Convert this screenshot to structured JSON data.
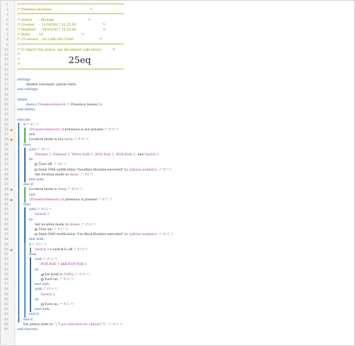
{
  "colors": {
    "comment": "#8a8a00",
    "keyword": "#2e55b8",
    "device": "#a040a0",
    "value": "#a040a0",
    "text": "#333333",
    "gray": "#999999",
    "bar_green": "#4caf50",
    "bar_blue": "#4a8ccf",
    "bar_blue2": "#2f6fa8",
    "gutter_icon": "#e08040"
  },
  "large_text": "25eq",
  "lines": [
    {
      "n": "1",
      "indent": 0,
      "segs": [
        {
          "t": "/*****************************************************************",
          "c": "comment"
        }
      ]
    },
    {
      "n": "2",
      "indent": 0,
      "segs": [
        {
          "t": "/* Presence Routines                                     */",
          "c": "comment"
        }
      ]
    },
    {
      "n": "3",
      "indent": 0,
      "segs": [
        {
          "t": "/*****************************************************************",
          "c": "comment"
        }
      ]
    },
    {
      "n": "4",
      "indent": 0,
      "segs": [
        {
          "t": "/* Author      : Michael                                 */",
          "c": "comment"
        }
      ]
    },
    {
      "n": "5",
      "indent": 0,
      "segs": [
        {
          "t": "/* Created     : 11/10/2017 22:25:39                          */",
          "c": "comment"
        }
      ]
    },
    {
      "n": "6",
      "indent": 0,
      "segs": [
        {
          "t": "/* Modified    : 28/10/2017 21:55:46                          */",
          "c": "comment"
        }
      ]
    },
    {
      "n": "7",
      "indent": 0,
      "segs": [
        {
          "t": "/* Build       : 19                                     */",
          "c": "comment"
        }
      ]
    },
    {
      "n": "8",
      "indent": 0,
      "segs": [
        {
          "t": "/* UI version  : v0.2.0fb.20171026                         */",
          "c": "comment"
        }
      ]
    },
    {
      "n": "9",
      "indent": 0,
      "segs": [
        {
          "t": "/*****************************************************************",
          "c": "comment"
        }
      ]
    },
    {
      "n": "10",
      "indent": 0,
      "segs": [
        {
          "t": "/* To import this piston, use the import code below:          */",
          "c": "comment"
        }
      ]
    },
    {
      "n": "11",
      "indent": 0,
      "segs": [
        {
          "t": "/*",
          "c": "comment"
        }
      ]
    },
    {
      "n": "12",
      "indent": 0,
      "segs": [
        {
          "t": "/*",
          "c": "comment"
        }
      ]
    },
    {
      "n": "13",
      "indent": 0,
      "segs": [
        {
          "t": "/*",
          "c": "comment"
        }
      ]
    },
    {
      "n": "14",
      "indent": 0,
      "segs": [
        {
          "t": "/*****************************************************************",
          "c": "comment"
        }
      ]
    },
    {
      "n": "15",
      "indent": 0,
      "segs": []
    },
    {
      "n": "16",
      "indent": 0,
      "segs": [
        {
          "t": "settings",
          "c": "keyword"
        }
      ]
    },
    {
      "n": "17",
      "indent": 3,
      "segs": [
        {
          "t": "disable automatic piston state;",
          "c": "text"
        }
      ]
    },
    {
      "n": "18",
      "indent": 0,
      "segs": [
        {
          "t": "end settings;",
          "c": "keyword"
        }
      ]
    },
    {
      "n": "19",
      "indent": 0,
      "segs": []
    },
    {
      "n": "20",
      "indent": 0,
      "segs": [
        {
          "t": "define",
          "c": "keyword"
        }
      ]
    },
    {
      "n": "21",
      "indent": 3,
      "segs": [
        {
          "t": "device ",
          "c": "keyword"
        },
        {
          "t": "PresenceSensors",
          "c": "device"
        },
        {
          "t": " = Presence Sensor 3;",
          "c": "text"
        }
      ]
    },
    {
      "n": "22",
      "indent": 0,
      "segs": [
        {
          "t": "end define;",
          "c": "keyword"
        }
      ]
    },
    {
      "n": "23",
      "indent": 0,
      "segs": []
    },
    {
      "n": "24",
      "indent": 0,
      "segs": [
        {
          "t": "execute",
          "c": "keyword"
        }
      ]
    },
    {
      "n": "25",
      "indent": 2,
      "segs": [
        {
          "t": "if ",
          "c": "keyword"
        },
        {
          "t": "/* #2 */",
          "c": "gray"
        }
      ]
    },
    {
      "n": "26",
      "indent": 4,
      "icon": true,
      "segs": [
        {
          "t": "{PresenceSensors}",
          "c": "device"
        },
        {
          "t": "'s presence is not present ",
          "c": "text"
        },
        {
          "t": "/* #26 */",
          "c": "gray"
        }
      ]
    },
    {
      "n": "27",
      "indent": 4,
      "segs": [
        {
          "t": "and",
          "c": "keyword"
        }
      ]
    },
    {
      "n": "28",
      "indent": 4,
      "icon": true,
      "segs": [
        {
          "t": "Location mode is not ",
          "c": "text"
        },
        {
          "t": "Away",
          "c": "value"
        },
        {
          "t": " /* #28 */",
          "c": "gray"
        }
      ]
    },
    {
      "n": "29",
      "indent": 2,
      "segs": [
        {
          "t": "then",
          "c": "keyword"
        }
      ]
    },
    {
      "n": "30",
      "indent": 4,
      "segs": [
        {
          "t": "with ",
          "c": "keyword"
        },
        {
          "t": "/* #5 */",
          "c": "gray"
        }
      ]
    },
    {
      "n": "31",
      "indent": 6,
      "segs": [
        {
          "t": "Dimmer 1, Dimmer 2, White Bulb 1, RGB Bulb 1, RGB Bulb 2, ",
          "c": "device"
        },
        {
          "t": "and ",
          "c": "text"
        },
        {
          "t": "Switch 2",
          "c": "device"
        }
      ]
    },
    {
      "n": "32",
      "indent": 4,
      "segs": [
        {
          "t": "do",
          "c": "keyword"
        }
      ]
    },
    {
      "n": "33",
      "indent": 6,
      "ic": "power",
      "segs": [
        {
          "t": " Turn off; ",
          "c": "text"
        },
        {
          "t": "/* #6 */",
          "c": "gray"
        }
      ]
    },
    {
      "n": "34",
      "indent": 6,
      "ic": "msg",
      "segs": [
        {
          "t": " Send SMS notification \"Goodbye Routine executed\" to ",
          "c": "text"
        },
        {
          "t": "{phone number}",
          "c": "value"
        },
        {
          "t": "; /* #7 */",
          "c": "gray"
        }
      ]
    },
    {
      "n": "35",
      "indent": 6,
      "segs": [
        {
          "t": "Set location mode to ",
          "c": "text"
        },
        {
          "t": "Away",
          "c": "value"
        },
        {
          "t": "; /* #8 */",
          "c": "gray"
        }
      ]
    },
    {
      "n": "36",
      "indent": 4,
      "segs": [
        {
          "t": "end with;",
          "c": "keyword"
        }
      ]
    },
    {
      "n": "37",
      "indent": 2,
      "segs": [
        {
          "t": "else if",
          "c": "keyword"
        }
      ]
    },
    {
      "n": "38",
      "indent": 4,
      "icon": true,
      "segs": [
        {
          "t": "Location mode is ",
          "c": "text"
        },
        {
          "t": "Away",
          "c": "value"
        },
        {
          "t": " /* #30 */",
          "c": "gray"
        }
      ]
    },
    {
      "n": "39",
      "indent": 4,
      "segs": [
        {
          "t": "and",
          "c": "keyword"
        }
      ]
    },
    {
      "n": "40",
      "indent": 4,
      "icon": true,
      "segs": [
        {
          "t": "{PresenceSensors}",
          "c": "device"
        },
        {
          "t": "'s presence is present ",
          "c": "text"
        },
        {
          "t": "/* #27 */",
          "c": "gray"
        }
      ]
    },
    {
      "n": "41",
      "indent": 2,
      "segs": [
        {
          "t": "then",
          "c": "keyword"
        }
      ]
    },
    {
      "n": "42",
      "indent": 4,
      "segs": [
        {
          "t": "with ",
          "c": "keyword"
        },
        {
          "t": "/* #16 */",
          "c": "gray"
        }
      ]
    },
    {
      "n": "43",
      "indent": 6,
      "segs": [
        {
          "t": "Switch 3",
          "c": "device"
        }
      ]
    },
    {
      "n": "44",
      "indent": 4,
      "segs": [
        {
          "t": "do",
          "c": "keyword"
        }
      ]
    },
    {
      "n": "45",
      "indent": 6,
      "segs": [
        {
          "t": "Set location mode to ",
          "c": "text"
        },
        {
          "t": "Home",
          "c": "value"
        },
        {
          "t": "; /* #14 */",
          "c": "gray"
        }
      ]
    },
    {
      "n": "46",
      "indent": 6,
      "ic": "power",
      "segs": [
        {
          "t": " Turn on; ",
          "c": "text"
        },
        {
          "t": "/* #17 */",
          "c": "gray"
        }
      ]
    },
    {
      "n": "47",
      "indent": 6,
      "ic": "msg",
      "segs": [
        {
          "t": " Send SMS notification \"I'm Back Routine executed\" to ",
          "c": "text"
        },
        {
          "t": "{phone number}",
          "c": "value"
        },
        {
          "t": "; /* #15 */",
          "c": "gray"
        }
      ]
    },
    {
      "n": "48",
      "indent": 4,
      "segs": [
        {
          "t": "end with;",
          "c": "keyword"
        }
      ]
    },
    {
      "n": "49",
      "indent": 4,
      "segs": [
        {
          "t": "if ",
          "c": "keyword"
        },
        {
          "t": "/* #12 */",
          "c": "gray"
        }
      ]
    },
    {
      "n": "50",
      "indent": 6,
      "icon": true,
      "segs": [
        {
          "t": "Switch 1",
          "c": "device"
        },
        {
          "t": "'s switch is off ",
          "c": "text"
        },
        {
          "t": "/* #18 */",
          "c": "gray"
        }
      ]
    },
    {
      "n": "51",
      "indent": 4,
      "segs": [
        {
          "t": "then",
          "c": "keyword"
        }
      ]
    },
    {
      "n": "52",
      "indent": 6,
      "segs": [
        {
          "t": "with ",
          "c": "keyword"
        },
        {
          "t": "/* #21 */",
          "c": "gray"
        }
      ]
    },
    {
      "n": "53",
      "indent": 8,
      "segs": [
        {
          "t": "RGB Bulb 1",
          "c": "device"
        },
        {
          "t": " and ",
          "c": "text"
        },
        {
          "t": "RGB Bulb 2",
          "c": "device"
        }
      ]
    },
    {
      "n": "54",
      "indent": 6,
      "segs": [
        {
          "t": "do",
          "c": "keyword"
        }
      ]
    },
    {
      "n": "55",
      "indent": 8,
      "ic": "level",
      "segs": [
        {
          "t": " Set level to ",
          "c": "text"
        },
        {
          "t": "100%",
          "c": "value"
        },
        {
          "t": "; /* #23 */",
          "c": "gray"
        }
      ]
    },
    {
      "n": "56",
      "indent": 8,
      "ic": "power",
      "segs": [
        {
          "t": " Turn on; ",
          "c": "text"
        },
        {
          "t": "/* #22 */",
          "c": "gray"
        }
      ]
    },
    {
      "n": "57",
      "indent": 6,
      "segs": [
        {
          "t": "end with;",
          "c": "keyword"
        }
      ]
    },
    {
      "n": "58",
      "indent": 6,
      "segs": [
        {
          "t": "with ",
          "c": "keyword"
        },
        {
          "t": "/* #24 */",
          "c": "gray"
        }
      ]
    },
    {
      "n": "59",
      "indent": 8,
      "segs": [
        {
          "t": "Switch 2",
          "c": "device"
        }
      ]
    },
    {
      "n": "60",
      "indent": 6,
      "segs": [
        {
          "t": "do",
          "c": "keyword"
        }
      ]
    },
    {
      "n": "61",
      "indent": 8,
      "ic": "power",
      "segs": [
        {
          "t": " Turn on; ",
          "c": "text"
        },
        {
          "t": "/* #25 */",
          "c": "gray"
        }
      ]
    },
    {
      "n": "62",
      "indent": 6,
      "segs": [
        {
          "t": "end with;",
          "c": "keyword"
        }
      ]
    },
    {
      "n": "63",
      "indent": 4,
      "segs": [
        {
          "t": "end if;",
          "c": "keyword"
        }
      ]
    },
    {
      "n": "64",
      "indent": 2,
      "segs": [
        {
          "t": "end if;",
          "c": "keyword"
        }
      ]
    },
    {
      "n": "65",
      "indent": 2,
      "segs": [
        {
          "t": "Set piston state to ",
          "c": "text"
        },
        {
          "t": "\"{\"Last executed on {$now}\"}\"",
          "c": "value"
        },
        {
          "t": "; /* #32 */",
          "c": "gray"
        }
      ]
    },
    {
      "n": "66",
      "indent": 0,
      "segs": [
        {
          "t": "end execute;",
          "c": "keyword"
        }
      ]
    }
  ]
}
